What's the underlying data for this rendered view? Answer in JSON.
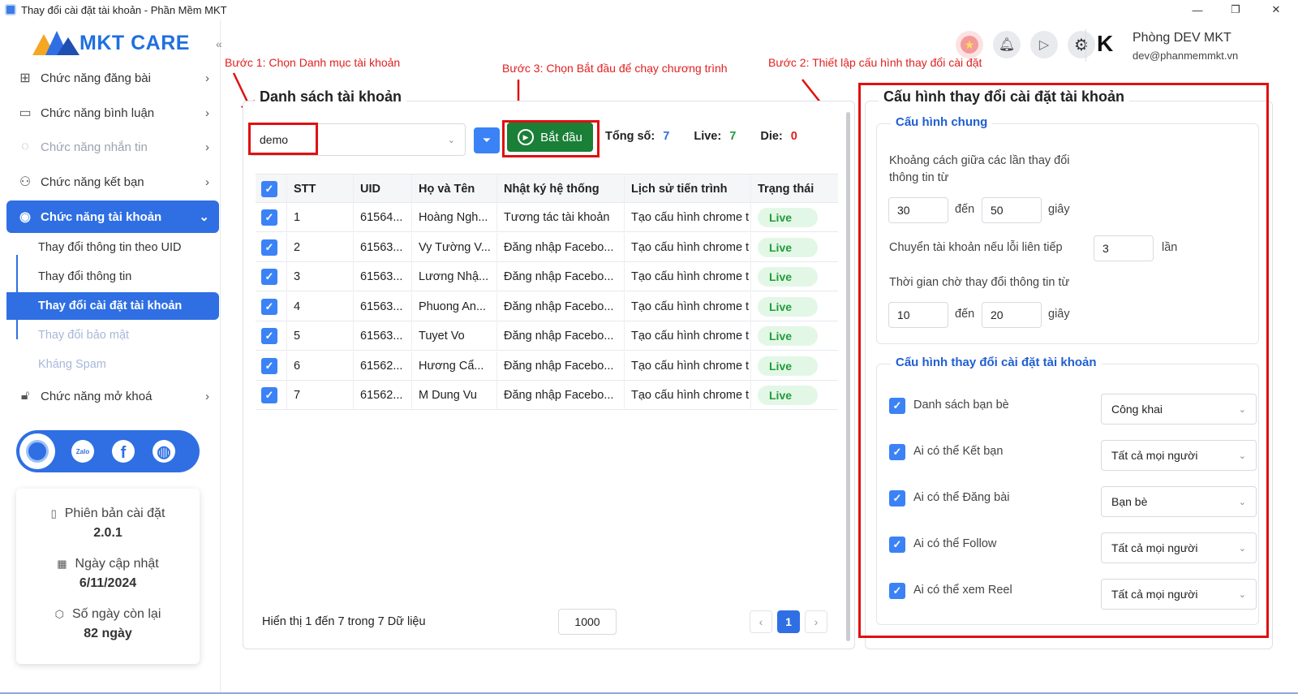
{
  "window": {
    "title": "Thay đổi cài đặt tài khoản - Phần Mềm MKT",
    "minimize": "—",
    "maximize": "❐",
    "close": "✕"
  },
  "brand": {
    "name": "MKT CARE"
  },
  "sidebar": {
    "menu": [
      {
        "label": "Chức năng đăng bài",
        "icon": "post-icon"
      },
      {
        "label": "Chức năng bình luận",
        "icon": "comment-icon"
      },
      {
        "label": "Chức năng nhắn tin",
        "icon": "message-icon"
      },
      {
        "label": "Chức năng kết bạn",
        "icon": "add-friend-icon"
      },
      {
        "label": "Chức năng tài khoản",
        "icon": "account-icon"
      },
      {
        "label": "Chức năng mở khoá",
        "icon": "unlock-icon"
      }
    ],
    "submenu": [
      "Thay đổi thông tin theo UID",
      "Thay đổi thông tin",
      "Thay đổi cài đặt tài khoản",
      "Thay đổi bảo mật",
      "Kháng Spam"
    ],
    "social": [
      "support-icon",
      "zalo-icon",
      "facebook-icon",
      "globe-icon"
    ],
    "social_zalo": "Zalo",
    "info": {
      "version_label": "Phiên bản cài đặt",
      "version": "2.0.1",
      "updated_label": "Ngày cập nhật",
      "updated": "6/11/2024",
      "remaining_label": "Số ngày còn lại",
      "remaining": "82 ngày"
    }
  },
  "header": {
    "user_name": "Phòng DEV MKT",
    "user_email": "dev@phanmemmkt.vn",
    "avatar_letter": "K"
  },
  "annotations": {
    "step1": "Bước 1: Chọn Danh mục tài khoản",
    "step2": "Bước 2: Thiết lập cấu hình thay đổi cài đặt",
    "step3": "Bước 3: Chọn Bắt đầu để chạy chương trình"
  },
  "accounts": {
    "title": "Danh sách tài khoản",
    "category": "demo",
    "start_label": "Bắt đầu",
    "total_label": "Tổng số:",
    "total": "7",
    "live_label": "Live:",
    "live": "7",
    "die_label": "Die:",
    "die": "0",
    "columns": [
      "STT",
      "UID",
      "Họ và Tên",
      "Nhật ký hệ thống",
      "Lịch sử tiến trình",
      "Trạng thái"
    ],
    "rows": [
      [
        "1",
        "61564...",
        "Hoàng Ngh...",
        "Tương tác tài khoản",
        "Tạo cấu hình chrome t",
        "Live"
      ],
      [
        "2",
        "61563...",
        "Vy Tường V...",
        "Đăng nhập Facebo...",
        "Tạo cấu hình chrome t",
        "Live"
      ],
      [
        "3",
        "61563...",
        "Lương Nhậ...",
        "Đăng nhập Facebo...",
        "Tạo cấu hình chrome t",
        "Live"
      ],
      [
        "4",
        "61563...",
        "Phuong An...",
        "Đăng nhập Facebo...",
        "Tạo cấu hình chrome t",
        "Live"
      ],
      [
        "5",
        "61563...",
        "Tuyet Vo",
        "Đăng nhập Facebo...",
        "Tạo cấu hình chrome t",
        "Live"
      ],
      [
        "6",
        "61562...",
        "Hương Cẩ...",
        "Đăng nhập Facebo...",
        "Tạo cấu hình chrome t",
        "Live"
      ],
      [
        "7",
        "61562...",
        "M Dung Vu",
        "Đăng nhập Facebo...",
        "Tạo cấu hình chrome t",
        "Live"
      ]
    ],
    "footer": "Hiển thị 1 đến 7 trong 7 Dữ liệu",
    "page_size": "1000",
    "page": "1"
  },
  "config": {
    "title": "Cấu hình thay đổi cài đặt tài khoản",
    "general_title": "Cấu hình chung",
    "interval_label": "Khoảng cách giữa các lần thay đổi thông tin từ",
    "interval_from": "30",
    "interval_to": "50",
    "to_label": "đến",
    "seconds_label": "giây",
    "switch_label": "Chuyển tài khoản nếu lỗi liên tiếp",
    "switch_value": "3",
    "times_label": "lần",
    "wait_label": "Thời gian chờ thay đổi thông tin từ",
    "wait_from": "10",
    "wait_to": "20",
    "settings_title": "Cấu hình thay đổi cài đặt tài khoản",
    "options": [
      {
        "label": "Danh sách bạn bè",
        "value": "Công khai"
      },
      {
        "label": "Ai có thể Kết bạn",
        "value": "Tất cả mọi người"
      },
      {
        "label": "Ai có thể Đăng bài",
        "value": "Bạn bè"
      },
      {
        "label": "Ai có thể Follow",
        "value": "Tất cả mọi người"
      },
      {
        "label": "Ai có thể xem Reel",
        "value": "Tất cả mọi người"
      }
    ]
  },
  "colors": {
    "primary": "#2f6fe3",
    "start": "#1a7f37",
    "live_text": "#1f9d3a",
    "die": "#e02020",
    "annotation": "#e01010"
  }
}
